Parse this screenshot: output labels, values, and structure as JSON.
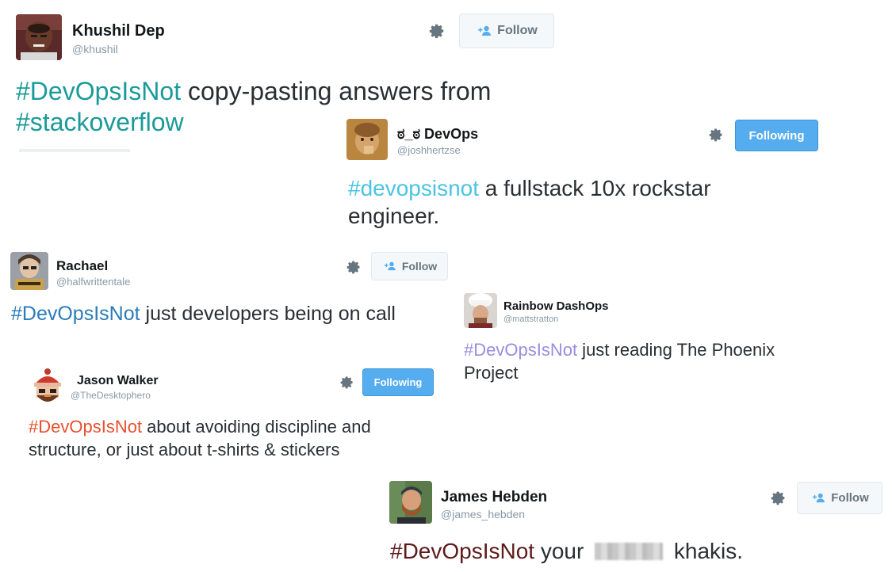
{
  "tweets": [
    {
      "name": "Khushil Dep",
      "handle": "@khushil",
      "button": "Follow",
      "hashtag": "#DevOpsIsNot",
      "text": " copy-pasting answers from ",
      "hashtag2": "#stackoverflow",
      "hashtag_color": "#1b9a9a",
      "avatar": "person-avatar"
    },
    {
      "name": "ಠ_ಠ DevOps",
      "handle": "@joshhertzse",
      "button": "Following",
      "hashtag": "#devopsisnot",
      "text": " a fullstack 10x rockstar engineer.",
      "hashtag_color": "#4ac4e3",
      "avatar": "person-avatar"
    },
    {
      "name": "Rachael",
      "handle": "@halfwrittentale",
      "button": "Follow",
      "hashtag": "#DevOpsIsNot",
      "text": " just developers being on call",
      "hashtag_color": "#2b7bb9",
      "avatar": "person-avatar"
    },
    {
      "name": "Rainbow DashOps",
      "handle": "@mattstratton",
      "hashtag": "#DevOpsIsNot",
      "text": " just reading The Phoenix Project",
      "hashtag_color": "#9b8ce0",
      "avatar": "chef-hat-avatar"
    },
    {
      "name": "Jason Walker",
      "handle": "@TheDesktophero",
      "button": "Following",
      "hashtag": "#DevOpsIsNot",
      "text": " about avoiding discipline and structure, or just about t-shirts & stickers",
      "hashtag_color": "#e8502e",
      "avatar": "cartoon-avatar"
    },
    {
      "name": "James Hebden",
      "handle": "@james_hebden",
      "button": "Follow",
      "hashtag": "#DevOpsIsNot",
      "text_before": " your ",
      "text_after": " khakis.",
      "hashtag_color": "#5e1a1a",
      "avatar": "person-avatar"
    }
  ]
}
